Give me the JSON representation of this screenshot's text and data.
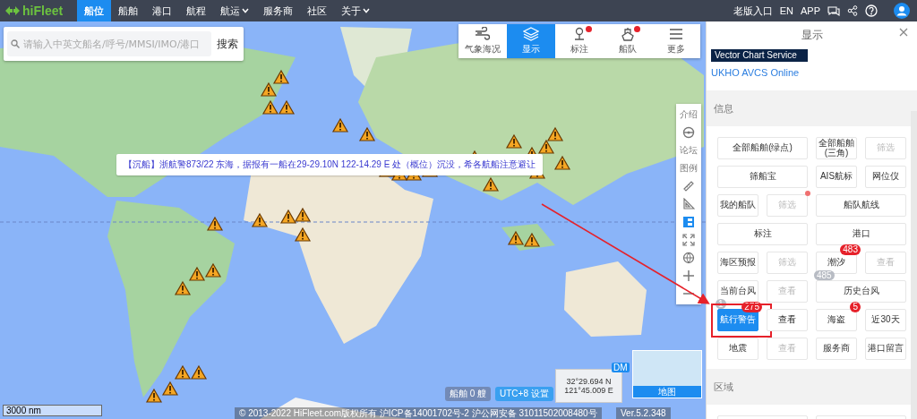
{
  "topbar": {
    "logo": "hiFleet",
    "items": [
      {
        "label": "船位",
        "selected": true,
        "kind": "link"
      },
      {
        "label": "船舶",
        "selected": false,
        "kind": "link"
      },
      {
        "label": "港口",
        "selected": false,
        "kind": "link"
      },
      {
        "label": "航程",
        "selected": false,
        "kind": "link"
      },
      {
        "label": "航运",
        "selected": false,
        "kind": "dropdown"
      },
      {
        "label": "服务商",
        "selected": false,
        "kind": "link"
      },
      {
        "label": "社区",
        "selected": false,
        "kind": "link"
      },
      {
        "label": "关于",
        "selected": false,
        "kind": "dropdown"
      }
    ],
    "right_links": [
      "老版入口",
      "EN",
      "APP"
    ]
  },
  "search": {
    "placeholder": "请输入中英文船名/呼号/MMSI/IMO/港口",
    "button": "搜索"
  },
  "toolbar": [
    {
      "label": "气象海况",
      "selected": false,
      "dot": false
    },
    {
      "label": "显示",
      "selected": true,
      "dot": false
    },
    {
      "label": "标注",
      "selected": false,
      "dot": true
    },
    {
      "label": "船队",
      "selected": false,
      "dot": true
    },
    {
      "label": "更多",
      "selected": false,
      "dot": false
    }
  ],
  "notice": "【沉船】浙航警873/22 东海，据报有一船在29-29.10N 122-14.29 E 处（概位）沉没，希各航船注意避让",
  "map_tools": [
    "介绍",
    "论坛",
    "图例"
  ],
  "status": {
    "ship_count": "船舶 0 艘",
    "timezone": "UTC+8 设置",
    "latitude": "32°29.694 N",
    "longitude": "121°45.009 E",
    "format": "DM",
    "minimap": "地图",
    "scale": "3000 nm",
    "copyright": "© 2013-2022 HiFleet.com版权所有 沪ICP备14001702号-2 沪公网安备 31011502008480号",
    "version": "Ver.5.2.348"
  },
  "panel": {
    "title": "显示",
    "chart_banner": "Vector Chart Service",
    "chart_link": "UKHO AVCS Online",
    "sections": [
      {
        "title": "信息",
        "buttons": [
          {
            "label": "全部船舶(绿点)",
            "kind": "wide",
            "selected": false,
            "disabled": false
          },
          {
            "label": "全部船舶(三角)",
            "kind": "narrow",
            "selected": false,
            "disabled": false
          },
          {
            "label": "筛选",
            "kind": "narrow",
            "selected": false,
            "disabled": true
          },
          {
            "label": "筛船宝",
            "kind": "wide",
            "selected": false,
            "disabled": false
          },
          {
            "label": "AIS航标",
            "kind": "narrow",
            "selected": false,
            "disabled": false
          },
          {
            "label": "网位仪",
            "kind": "narrow",
            "selected": false,
            "disabled": false
          },
          {
            "label": "我的船队",
            "kind": "narrow",
            "selected": false,
            "disabled": false
          },
          {
            "label": "筛选",
            "kind": "narrow",
            "selected": false,
            "disabled": true,
            "dot": true
          },
          {
            "label": "船队航线",
            "kind": "wide",
            "selected": false,
            "disabled": false
          },
          {
            "label": "标注",
            "kind": "wide",
            "selected": false,
            "disabled": false
          },
          {
            "label": "港口",
            "kind": "wide",
            "selected": false,
            "disabled": false
          },
          {
            "label": "海区预报",
            "kind": "narrow",
            "selected": false,
            "disabled": false
          },
          {
            "label": "筛选",
            "kind": "narrow",
            "selected": false,
            "disabled": true
          },
          {
            "label": "潮汐",
            "kind": "narrow",
            "selected": false,
            "disabled": false,
            "badge": "483"
          },
          {
            "label": "查看",
            "kind": "narrow",
            "selected": false,
            "disabled": true
          },
          {
            "label": "当前台风",
            "kind": "narrow",
            "selected": false,
            "disabled": false
          },
          {
            "label": "查看",
            "kind": "narrow",
            "selected": false,
            "disabled": true
          },
          {
            "label": "历史台风",
            "kind": "wide",
            "selected": false,
            "disabled": false,
            "note": "485"
          },
          {
            "label": "航行警告",
            "kind": "narrow",
            "selected": true,
            "disabled": false,
            "badge": "275",
            "note": "1",
            "highlighted": true
          },
          {
            "label": "查看",
            "kind": "narrow",
            "selected": false,
            "disabled": false
          },
          {
            "label": "海盗",
            "kind": "narrow",
            "selected": false,
            "disabled": false,
            "badge": "5"
          },
          {
            "label": "近30天",
            "kind": "narrow",
            "selected": false,
            "disabled": false
          },
          {
            "label": "地震",
            "kind": "narrow",
            "selected": false,
            "disabled": false
          },
          {
            "label": "查看",
            "kind": "narrow",
            "selected": false,
            "disabled": true
          },
          {
            "label": "服务商",
            "kind": "narrow",
            "selected": false,
            "disabled": false
          },
          {
            "label": "港口留言",
            "kind": "narrow",
            "selected": false,
            "disabled": false
          }
        ]
      },
      {
        "title": "区域"
      }
    ]
  }
}
